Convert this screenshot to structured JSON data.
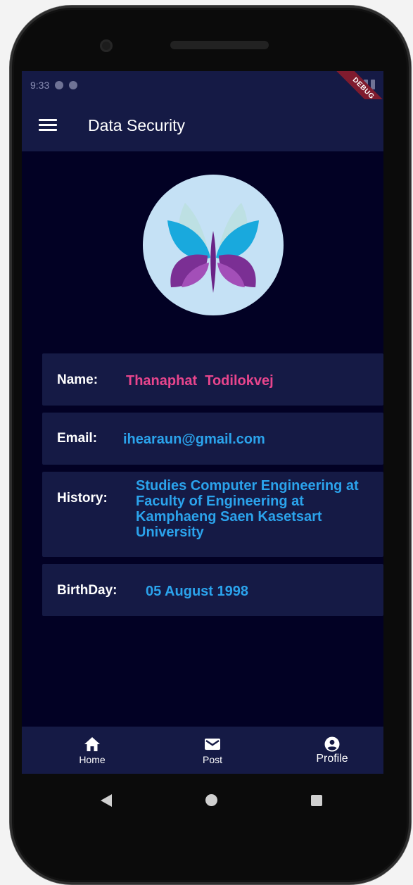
{
  "statusbar": {
    "time": "9:33",
    "debug_label": "DEBUG"
  },
  "appbar": {
    "title": "Data Security"
  },
  "profile": {
    "name_label": "Name:",
    "name_value": "Thanaphat  Todilokvej",
    "email_label": "Email:",
    "email_value": "ihearaun@gmail.com",
    "history_label": "History:",
    "history_value": "Studies Computer Engineering at Faculty of Engineering at Kamphaeng Saen Kasetsart University",
    "birthday_label": "BirthDay:",
    "birthday_value": "05 August 1998"
  },
  "bottomnav": {
    "items": [
      {
        "label": "Home",
        "icon": "home-icon"
      },
      {
        "label": "Post",
        "icon": "mail-icon"
      },
      {
        "label": "Profile",
        "icon": "account-circle-icon"
      }
    ]
  },
  "colors": {
    "background": "#020124",
    "bar": "#151a45",
    "name_accent": "#e8458d",
    "value_accent": "#2ba3ec",
    "avatar_bg": "#c5e1f5"
  }
}
